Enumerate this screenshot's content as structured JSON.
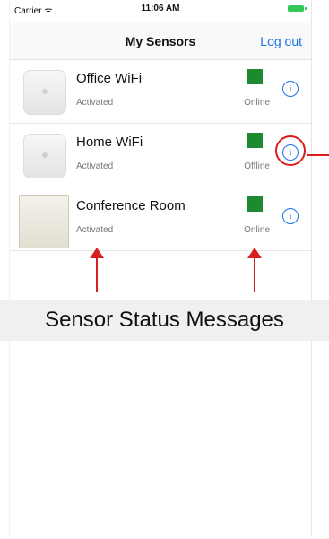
{
  "status_bar": {
    "carrier": "Carrier ᯤ",
    "time": "11:06 AM"
  },
  "nav": {
    "title": "My Sensors",
    "logout_label": "Log out"
  },
  "sensors": [
    {
      "name": "Office WiFi",
      "activation": "Activated",
      "connection": "Online",
      "indicator_color": "#1e8a2f",
      "icon": "info-icon"
    },
    {
      "name": "Home WiFi",
      "activation": "Activated",
      "connection": "Offline",
      "indicator_color": "#1e8a2f",
      "icon": "info-icon"
    },
    {
      "name": "Conference Room",
      "activation": "Activated",
      "connection": "Online",
      "indicator_color": "#1e8a2f",
      "icon": "info-icon"
    }
  ],
  "annotation": {
    "caption": "Sensor Status Messages",
    "highlight_color": "#d91e1e"
  }
}
